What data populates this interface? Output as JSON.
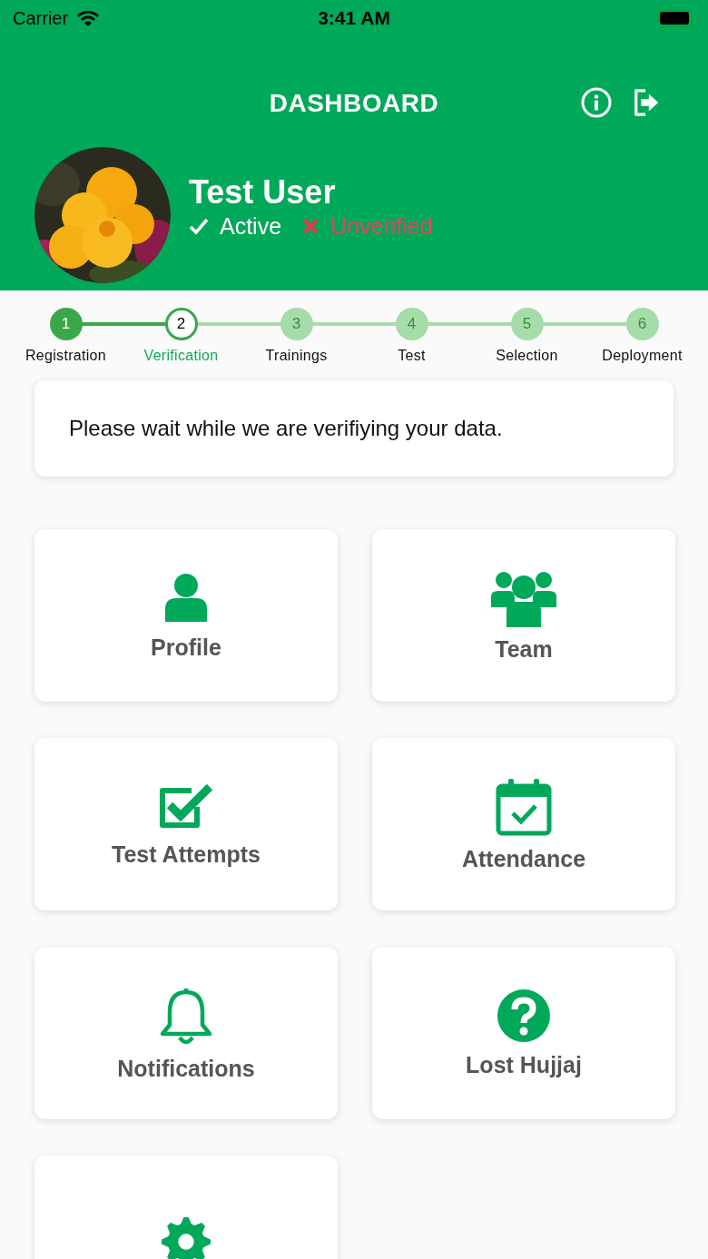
{
  "status_bar": {
    "carrier": "Carrier",
    "time": "3:41 AM"
  },
  "header": {
    "title": "DASHBOARD"
  },
  "user": {
    "name": "Test User",
    "badges": [
      {
        "kind": "ok",
        "label": "Active"
      },
      {
        "kind": "fail",
        "label": "Unverified"
      }
    ]
  },
  "steps": [
    {
      "number": "1",
      "label": "Registration",
      "kind": "done"
    },
    {
      "number": "2",
      "label": "Verification",
      "kind": "current"
    },
    {
      "number": "3",
      "label": "Trainings",
      "kind": "pending"
    },
    {
      "number": "4",
      "label": "Test",
      "kind": "pending"
    },
    {
      "number": "5",
      "label": "Selection",
      "kind": "pending"
    },
    {
      "number": "6",
      "label": "Deployment",
      "kind": "pending"
    }
  ],
  "message": "Please wait while we are verifiying your data.",
  "tiles": [
    {
      "kind": "person",
      "label": "Profile"
    },
    {
      "kind": "team",
      "label": "Team"
    },
    {
      "kind": "checkbox",
      "label": "Test Attempts"
    },
    {
      "kind": "calendar",
      "label": "Attendance"
    },
    {
      "kind": "bell",
      "label": "Notifications"
    },
    {
      "kind": "question",
      "label": "Lost Hujjaj"
    },
    {
      "kind": "gear"
    }
  ]
}
